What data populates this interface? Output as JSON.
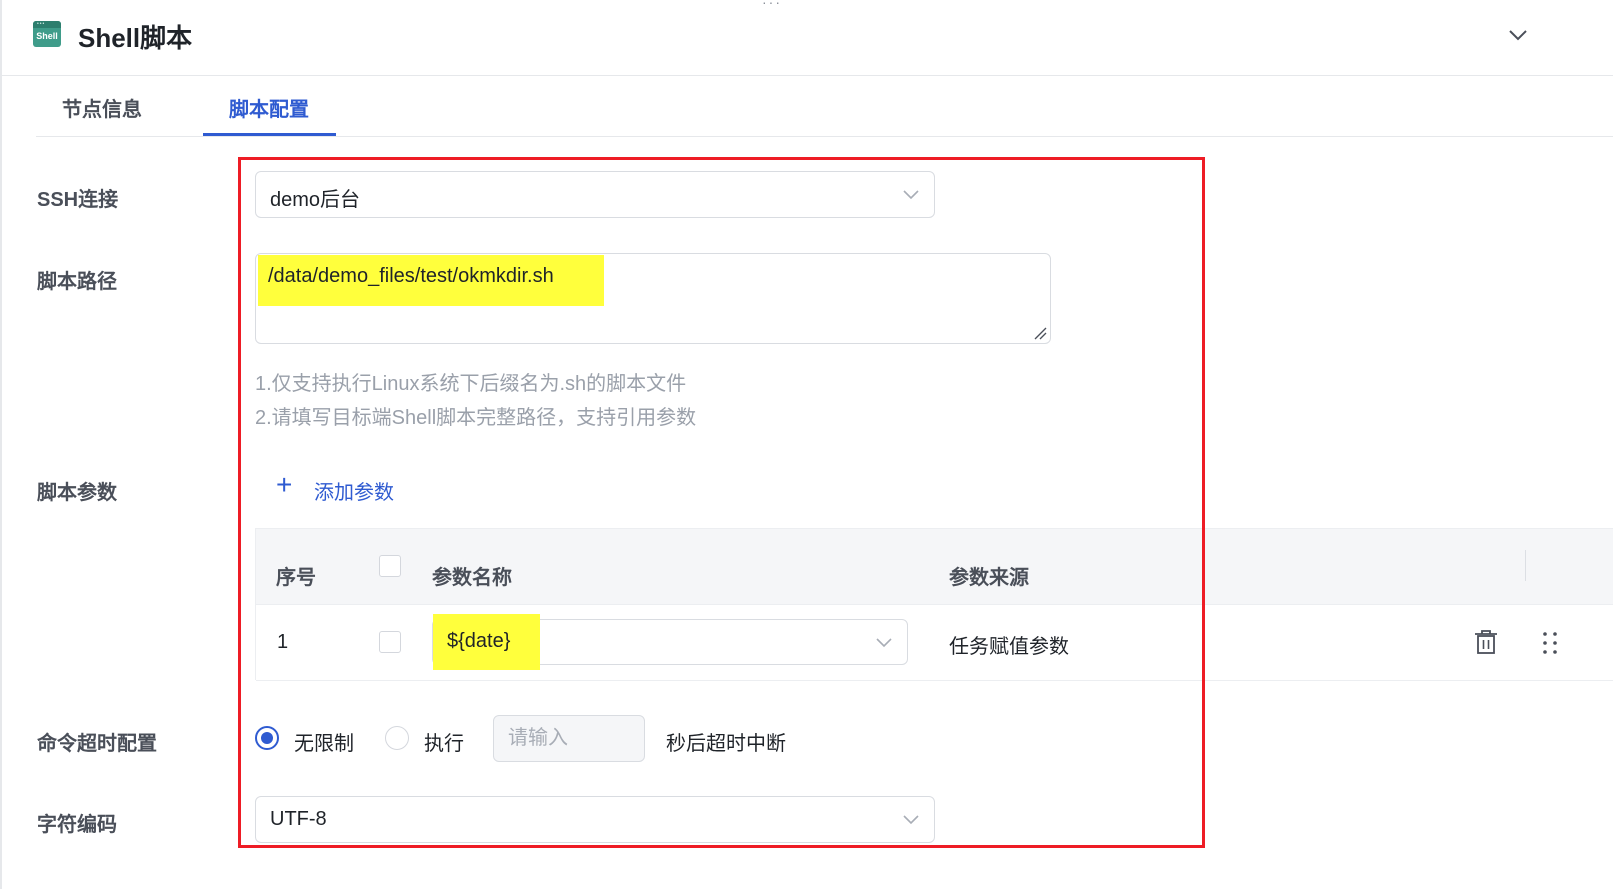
{
  "header": {
    "top_dots": "···",
    "icon_name": "shell-icon",
    "icon_text": "Shell",
    "title": "Shell脚本",
    "collapse_icon": "chevron-down-icon"
  },
  "tabs": [
    {
      "label": "节点信息",
      "active": false
    },
    {
      "label": "脚本配置",
      "active": true
    }
  ],
  "form": {
    "ssh": {
      "label": "SSH连接",
      "value": "demo后台"
    },
    "script_path": {
      "label": "脚本路径",
      "value": "/data/demo_files/test/okmkdir.sh",
      "hints": [
        "1.仅支持执行Linux系统下后缀名为.sh的脚本文件",
        "2.请填写目标端Shell脚本完整路径，支持引用参数"
      ]
    },
    "script_params": {
      "label": "脚本参数",
      "add_label": "添加参数",
      "columns": [
        "序号",
        "参数名称",
        "参数来源"
      ],
      "rows": [
        {
          "index": "1",
          "name": "${date}",
          "source": "任务赋值参数"
        }
      ]
    },
    "timeout": {
      "label": "命令超时配置",
      "option_unlimited": "无限制",
      "option_exec": "执行",
      "input_placeholder": "请输入",
      "suffix": "秒后超时中断",
      "selected": "无限制"
    },
    "encoding": {
      "label": "字符编码",
      "value": "UTF-8"
    }
  },
  "colors": {
    "accent": "#2f5bd1",
    "highlight": "#ffff3c",
    "annotation_border": "#ee1c25"
  }
}
